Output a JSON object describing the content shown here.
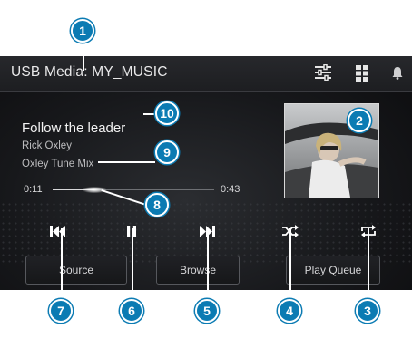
{
  "header": {
    "title": "USB Media: MY_MUSIC",
    "icons": [
      "sliders-icon",
      "grid-icon",
      "bell-icon"
    ]
  },
  "track": {
    "title": "Follow the leader",
    "artist": "Rick Oxley",
    "album": "Oxley Tune Mix",
    "elapsed": "0:11",
    "total": "0:43",
    "progress": 0.26
  },
  "controls": [
    "skip-previous-icon",
    "pause-icon",
    "skip-next-icon",
    "shuffle-icon",
    "repeat-icon"
  ],
  "buttons": {
    "source": "Source",
    "browse": "Browse",
    "play_queue": "Play Queue"
  },
  "callouts": [
    "1",
    "2",
    "3",
    "4",
    "5",
    "6",
    "7",
    "8",
    "9",
    "10"
  ],
  "colors": {
    "callout": "#0b7bb3",
    "screen_bg": "#17181b"
  }
}
